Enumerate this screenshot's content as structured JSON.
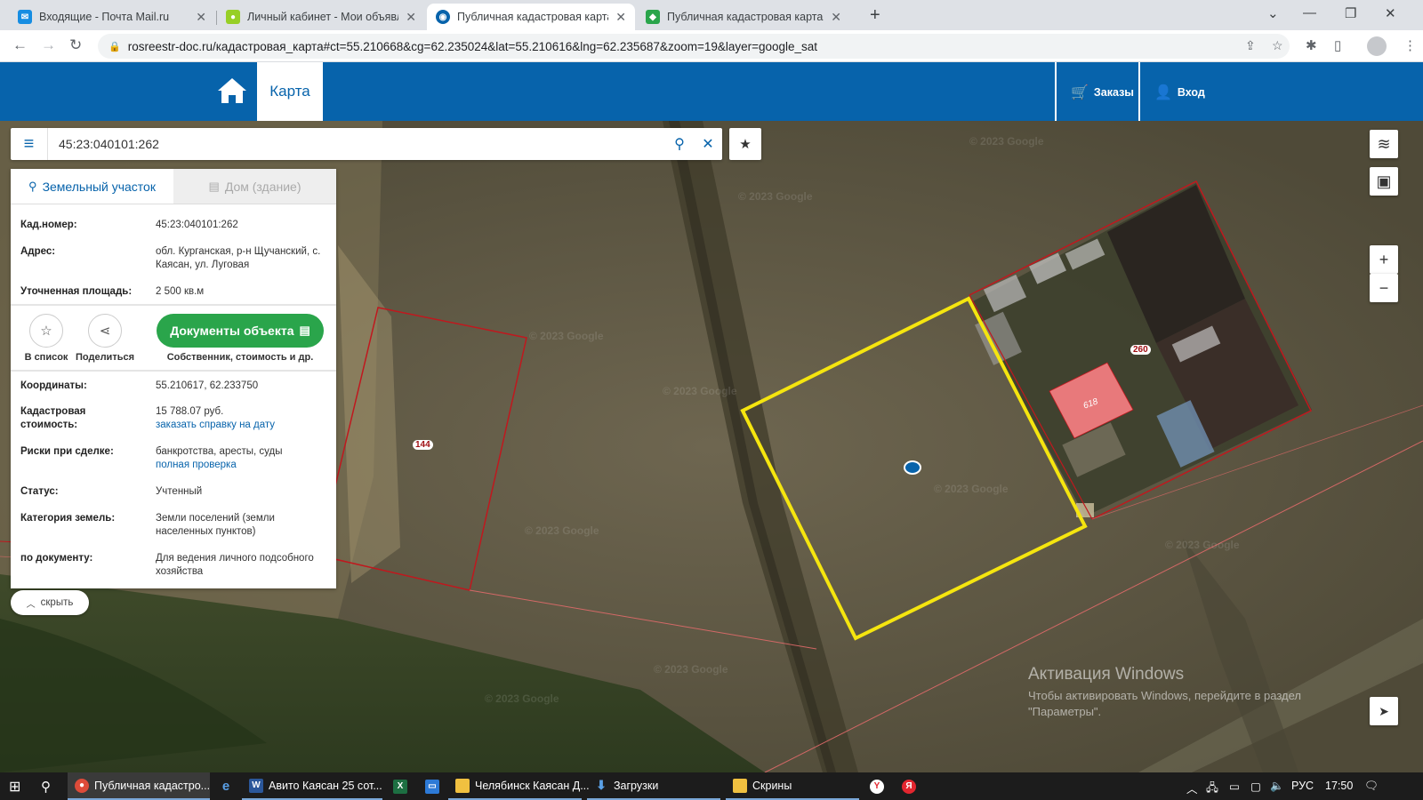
{
  "browser": {
    "tabs": [
      {
        "title": "Входящие - Почта Mail.ru",
        "icon": "mail-icon",
        "color": "#168de2"
      },
      {
        "title": "Личный кабинет - Мои объявл",
        "icon": "avito-icon",
        "color": "#97cf26"
      },
      {
        "title": "Публичная кадастровая карта 2",
        "icon": "rosreestr-icon",
        "color": "#0763ab"
      },
      {
        "title": "Публичная кадастровая карта: ",
        "icon": "pkk-icon",
        "color": "#2aa54b"
      }
    ],
    "url": "rosreestr-doc.ru/кадастровая_карта#ct=55.210668&cg=62.235024&lat=55.210616&lng=62.235687&zoom=19&layer=google_sat"
  },
  "header": {
    "map_tab": "Карта",
    "orders": "Заказы",
    "login": "Вход",
    "color": "#0763ab"
  },
  "search": {
    "value": "45:23:040101:262"
  },
  "panel": {
    "tab_land": "Земельный участок",
    "tab_house": "Дом (здание)",
    "cad_number_label": "Кад.номер:",
    "cad_number": "45:23:040101:262",
    "address_label": "Адрес:",
    "address": "обл. Курганская, р-н Щучанский, с. Каясан, ул. Луговая",
    "area_label": "Уточненная площадь:",
    "area": "2 500 кв.м",
    "to_list": "В список",
    "share": "Поделиться",
    "documents_button": "Документы объекта",
    "documents_sub": "Собственник, стоимость и др.",
    "coords_label": "Координаты:",
    "coords": "55.210617, 62.233750",
    "cost_label": "Кадастровая стоимость:",
    "cost": "15 788.07 руб.",
    "cost_link": "заказать справку на дату",
    "risks_label": "Риски при сделке:",
    "risks": "банкротства, аресты, суды",
    "risks_link": "полная проверка",
    "status_label": "Статус:",
    "status": "Учтенный",
    "category_label": "Категория земель:",
    "category": "Земли поселений (земли населенных пунктов)",
    "usage_label": "по документу:",
    "usage": "Для ведения личного подсобного хозяйства",
    "hide": "скрыть"
  },
  "map": {
    "labels": {
      "parcel_144": "144",
      "parcel_260": "260",
      "building_618": "618"
    },
    "watermark": "© 2023 Google",
    "selected_color": "#f5e50f",
    "parcel_color": "#c0181e",
    "building_color": "#e8797b"
  },
  "windows": {
    "activate_title": "Активация Windows",
    "activate_text_1": "Чтобы активировать Windows, перейдите в раздел",
    "activate_text_2": "\"Параметры\"."
  },
  "taskbar": {
    "items": [
      {
        "label": "Публичная кадастро...",
        "color": "#dd4b39"
      },
      {
        "label": "Авито Каясан 25 сот...",
        "color": "#2b579a"
      },
      {
        "label": "Челябинск Каясан Д...",
        "color": "#f0c040"
      },
      {
        "label": "Загрузки",
        "color": "#2d7ad6"
      },
      {
        "label": "Скрины",
        "color": "#f0c040"
      }
    ],
    "lang": "РУС",
    "time": "17:50"
  }
}
